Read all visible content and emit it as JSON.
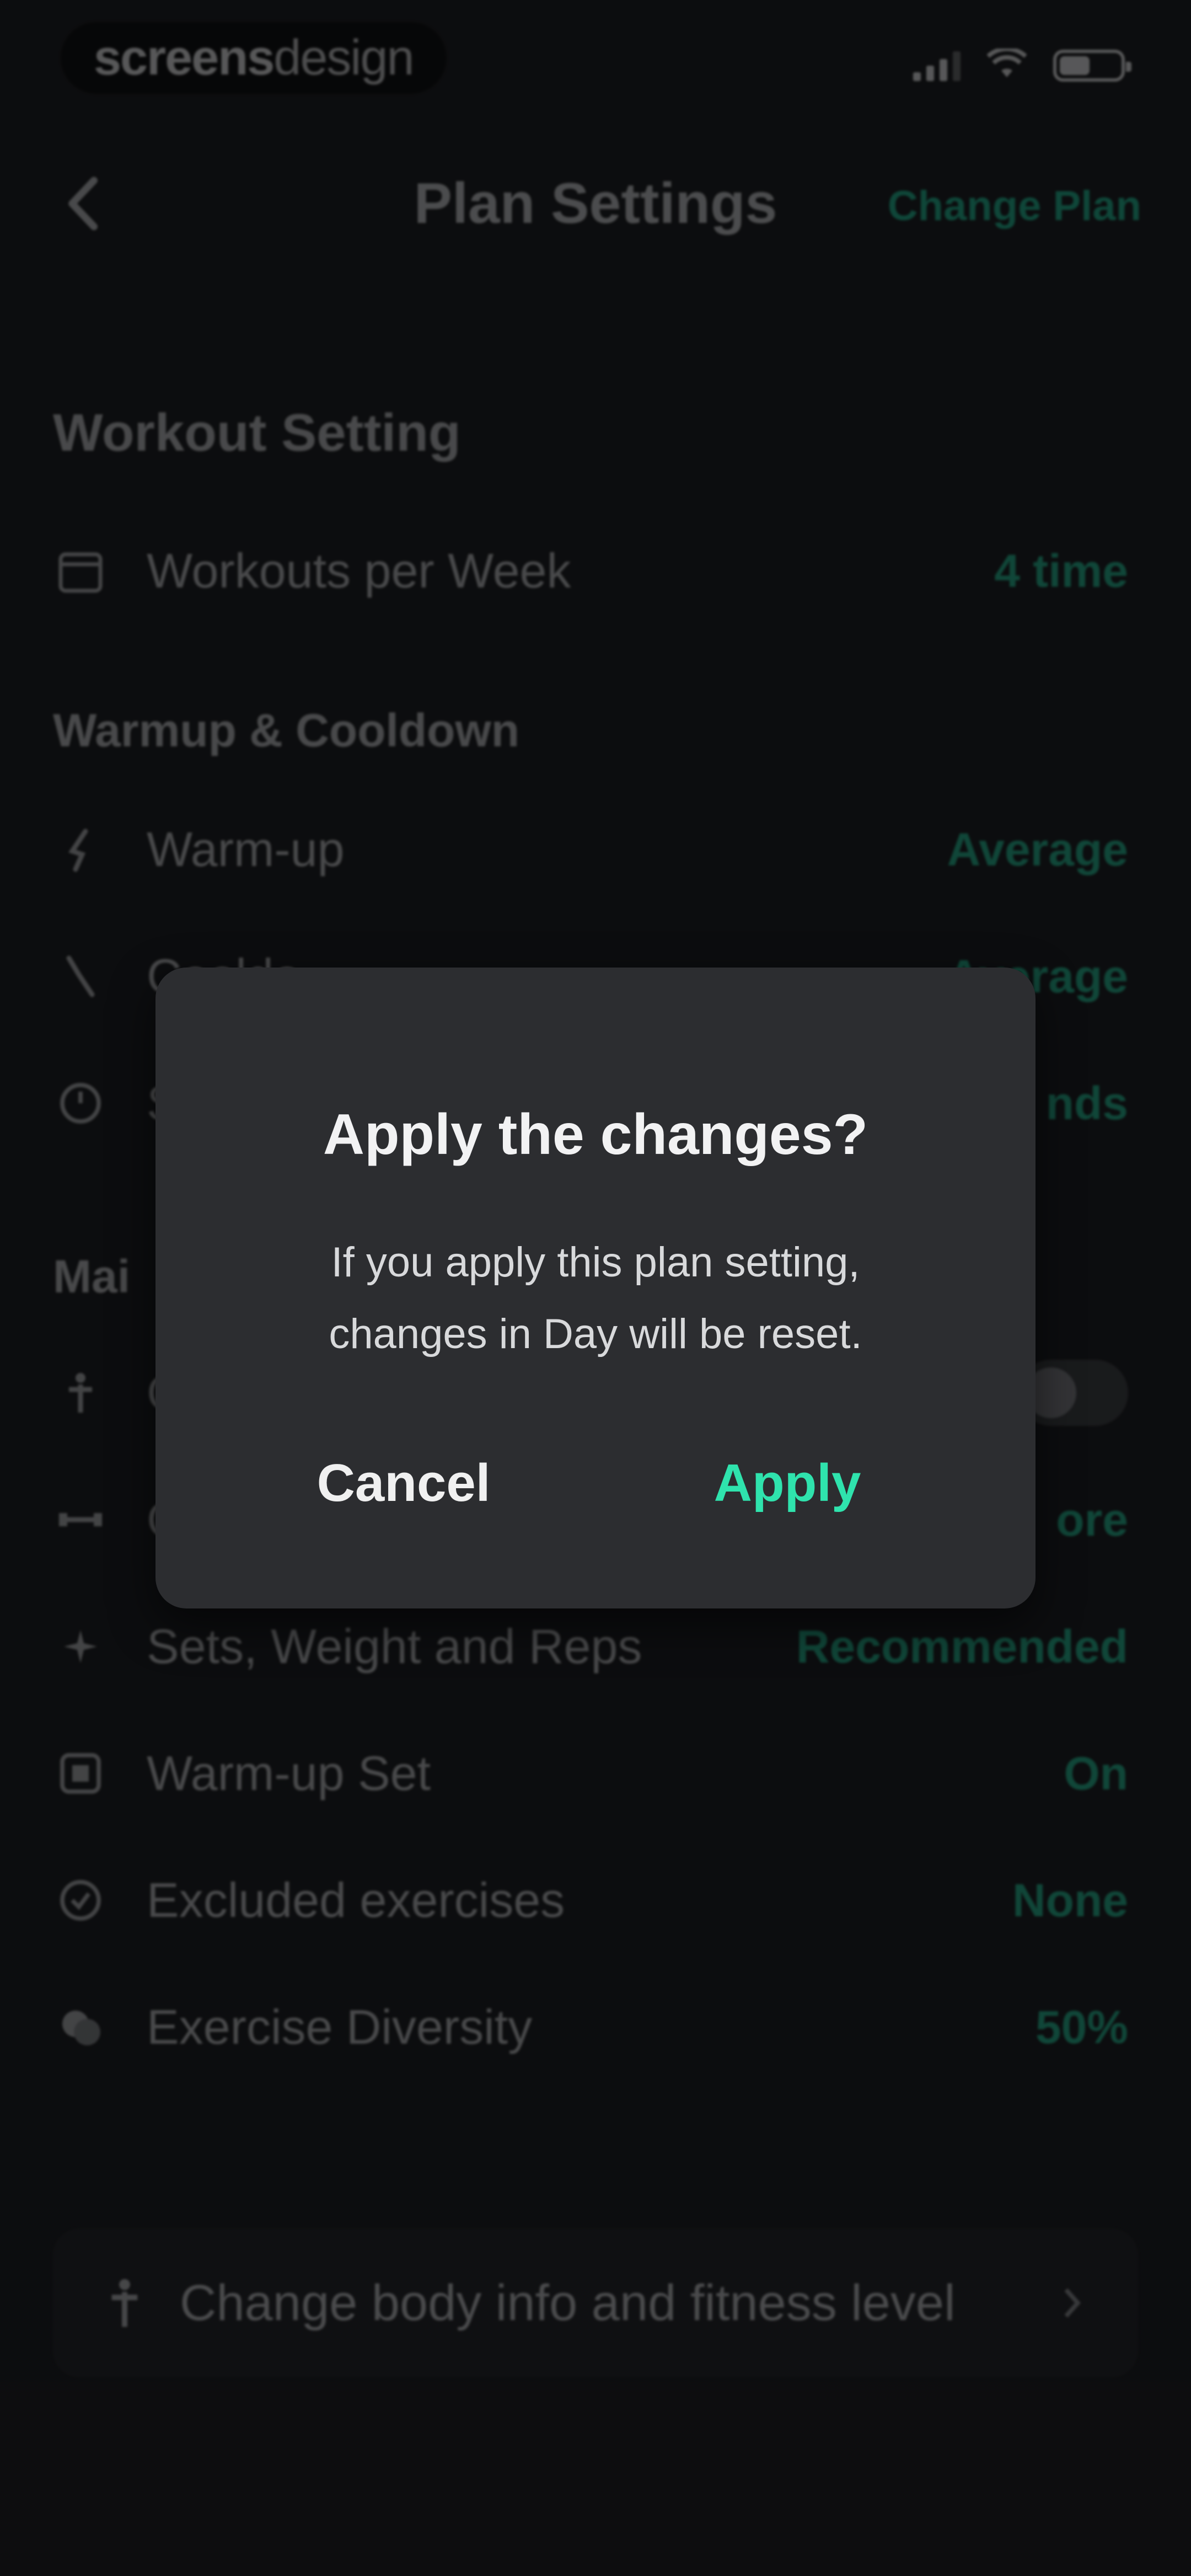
{
  "status_bar": {
    "brand_bold": "screens",
    "brand_light": "design"
  },
  "header": {
    "title": "Plan Settings",
    "action": "Change Plan"
  },
  "sections": {
    "workout_setting": "Workout Setting",
    "warmup_cooldown": "Warmup & Cooldown",
    "main": "Mai"
  },
  "rows": {
    "workouts_per_week": {
      "label": "Workouts per Week",
      "value": "4 time",
      "icon": "calendar-icon"
    },
    "warm_up": {
      "label": "Warm-up",
      "value": "Average",
      "icon": "runner-icon"
    },
    "cooldown": {
      "label": "Cooldo",
      "value": "Average",
      "icon": "stretch-icon"
    },
    "rest": {
      "label": "S",
      "value": "nds",
      "icon": "timer-icon"
    },
    "toggle_row": {
      "label": "C",
      "icon": "person-icon"
    },
    "equipment": {
      "label": "C",
      "value": "ore",
      "icon": "dumbbell-icon"
    },
    "sets_weight_reps": {
      "label": "Sets, Weight and Reps",
      "value": "Recommended",
      "icon": "sparkle-icon"
    },
    "warm_up_set": {
      "label": "Warm-up Set",
      "value": "On",
      "icon": "set-icon"
    },
    "excluded_exercises": {
      "label": "Excluded exercises",
      "value": "None",
      "icon": "check-circle-icon"
    },
    "exercise_diversity": {
      "label": "Exercise Diversity",
      "value": "50%",
      "icon": "diversity-icon"
    }
  },
  "bottom_card": {
    "label": "Change body info and fitness level",
    "icon": "body-icon"
  },
  "dialog": {
    "title": "Apply the changes?",
    "message_line1": "If you apply this plan setting,",
    "message_line2": "changes in Day will be reset.",
    "cancel_label": "Cancel",
    "apply_label": "Apply"
  },
  "colors": {
    "accent": "#2fe3ad",
    "background": "#111214",
    "dialog": "#2c2d30"
  }
}
